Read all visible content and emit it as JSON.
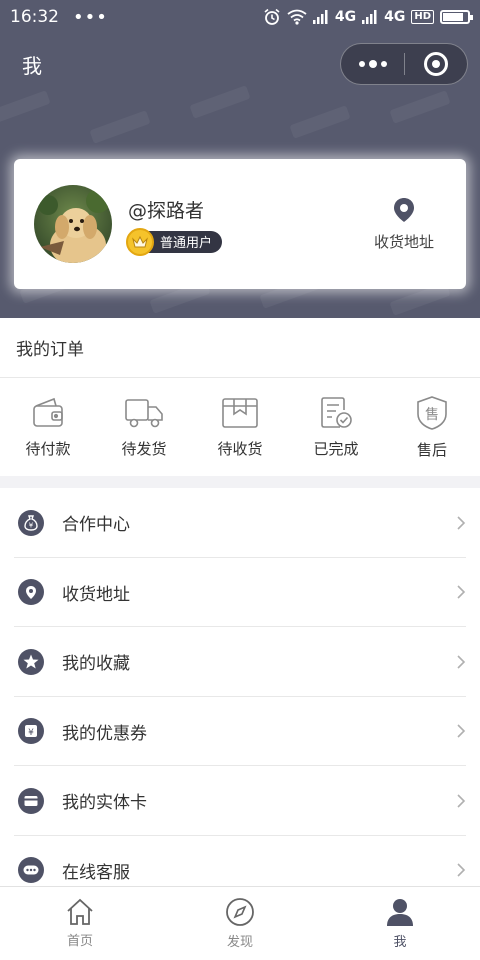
{
  "status_bar": {
    "time": "16:32",
    "dots": "•••",
    "signal1": "4G",
    "signal2": "4G",
    "hd": "HD"
  },
  "nav": {
    "title": "我"
  },
  "profile": {
    "username": "@探路者",
    "level": "普通用户",
    "address_label": "收货地址"
  },
  "orders": {
    "title": "我的订单",
    "items": [
      {
        "label": "待付款",
        "icon": "wallet-icon"
      },
      {
        "label": "待发货",
        "icon": "truck-icon"
      },
      {
        "label": "待收货",
        "icon": "package-icon"
      },
      {
        "label": "已完成",
        "icon": "completed-doc-icon"
      },
      {
        "label": "售后",
        "icon": "after-sale-icon"
      }
    ]
  },
  "menu": {
    "items": [
      {
        "label": "合作中心",
        "icon": "money-bag-icon"
      },
      {
        "label": "收货地址",
        "icon": "location-pin-icon"
      },
      {
        "label": "我的收藏",
        "icon": "star-icon"
      },
      {
        "label": "我的优惠券",
        "icon": "coupon-icon"
      },
      {
        "label": "我的实体卡",
        "icon": "card-icon"
      },
      {
        "label": "在线客服",
        "icon": "chat-icon"
      }
    ]
  },
  "tabs": [
    {
      "label": "首页",
      "icon": "home-icon",
      "active": false
    },
    {
      "label": "发现",
      "icon": "compass-icon",
      "active": false
    },
    {
      "label": "我",
      "icon": "person-icon",
      "active": true
    }
  ],
  "colors": {
    "header": "#575a6e",
    "accent": "#4f5266",
    "badge": "#333543",
    "crown": "#f5c32b"
  }
}
